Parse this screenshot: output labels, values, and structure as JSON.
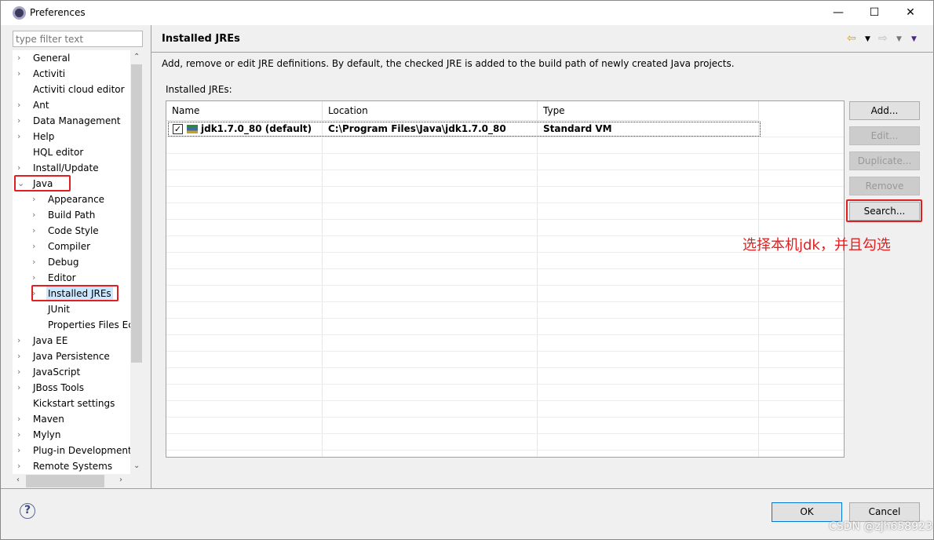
{
  "window": {
    "title": "Preferences",
    "controls": {
      "minimize": "—",
      "maximize": "☐",
      "close": "✕"
    }
  },
  "sidebar": {
    "filter_placeholder": "type filter text",
    "items": [
      {
        "label": "General",
        "level": 0,
        "expander": "›"
      },
      {
        "label": "Activiti",
        "level": 0,
        "expander": "›"
      },
      {
        "label": "Activiti cloud editor",
        "level": 0,
        "expander": ""
      },
      {
        "label": "Ant",
        "level": 0,
        "expander": "›"
      },
      {
        "label": "Data Management",
        "level": 0,
        "expander": "›"
      },
      {
        "label": "Help",
        "level": 0,
        "expander": "›"
      },
      {
        "label": "HQL editor",
        "level": 0,
        "expander": ""
      },
      {
        "label": "Install/Update",
        "level": 0,
        "expander": "›"
      },
      {
        "label": "Java",
        "level": 0,
        "expander": "⌄",
        "expanded": true,
        "highlighted": true
      },
      {
        "label": "Appearance",
        "level": 1,
        "expander": "›"
      },
      {
        "label": "Build Path",
        "level": 1,
        "expander": "›"
      },
      {
        "label": "Code Style",
        "level": 1,
        "expander": "›"
      },
      {
        "label": "Compiler",
        "level": 1,
        "expander": "›"
      },
      {
        "label": "Debug",
        "level": 1,
        "expander": "›"
      },
      {
        "label": "Editor",
        "level": 1,
        "expander": "›"
      },
      {
        "label": "Installed JREs",
        "level": 1,
        "expander": "›",
        "selected": true,
        "highlighted": true
      },
      {
        "label": "JUnit",
        "level": 1,
        "expander": ""
      },
      {
        "label": "Properties Files Ec",
        "level": 1,
        "expander": ""
      },
      {
        "label": "Java EE",
        "level": 0,
        "expander": "›"
      },
      {
        "label": "Java Persistence",
        "level": 0,
        "expander": "›"
      },
      {
        "label": "JavaScript",
        "level": 0,
        "expander": "›"
      },
      {
        "label": "JBoss Tools",
        "level": 0,
        "expander": "›"
      },
      {
        "label": "Kickstart settings",
        "level": 0,
        "expander": ""
      },
      {
        "label": "Maven",
        "level": 0,
        "expander": "›"
      },
      {
        "label": "Mylyn",
        "level": 0,
        "expander": "›"
      },
      {
        "label": "Plug-in Development",
        "level": 0,
        "expander": "›"
      },
      {
        "label": "Remote Systems",
        "level": 0,
        "expander": "›"
      }
    ]
  },
  "page": {
    "title": "Installed JREs",
    "description": "Add, remove or edit JRE definitions. By default, the checked JRE is added to the build path of newly created Java projects.",
    "list_label": "Installed JREs:",
    "columns": [
      "Name",
      "Location",
      "Type"
    ],
    "rows": [
      {
        "name": "jdk1.7.0_80 (default)",
        "location": "C:\\Program Files\\Java\\jdk1.7.0_80",
        "type": "Standard VM",
        "checked": true
      }
    ],
    "buttons": [
      {
        "label": "Add...",
        "enabled": true
      },
      {
        "label": "Edit...",
        "enabled": false
      },
      {
        "label": "Duplicate...",
        "enabled": false
      },
      {
        "label": "Remove",
        "enabled": false
      },
      {
        "label": "Search...",
        "enabled": true,
        "highlighted": true
      }
    ],
    "annotation": "选择本机jdk，并且勾选"
  },
  "footer": {
    "ok": "OK",
    "cancel": "Cancel",
    "help": "?"
  },
  "watermark": "CSDN @zjh658923",
  "colors": {
    "highlight": "#e02020",
    "selection": "#cce8ff"
  }
}
